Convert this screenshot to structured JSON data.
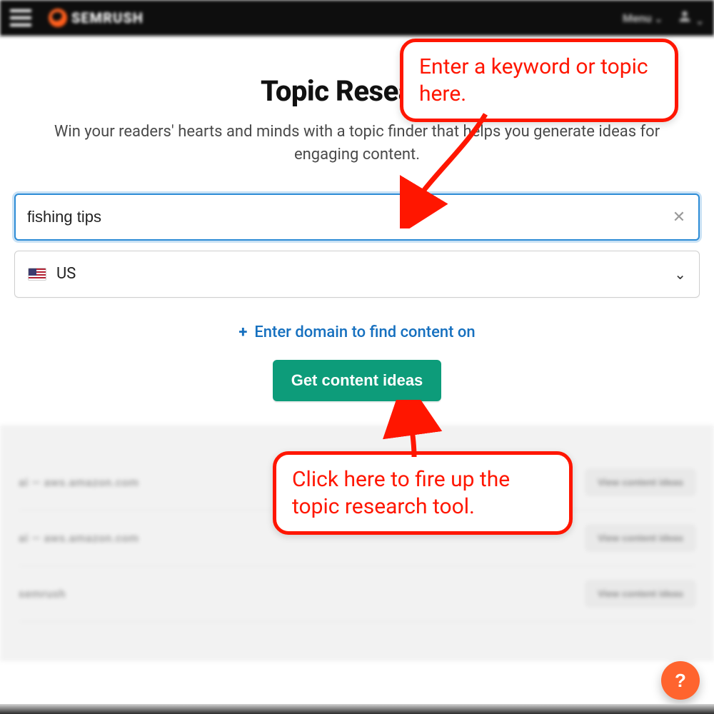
{
  "topbar": {
    "brand": "SEMRUSH",
    "menu_label": "Menu"
  },
  "page": {
    "title": "Topic Research",
    "subtitle": "Win your readers' hearts and minds with a topic finder that helps you generate ideas for engaging content."
  },
  "form": {
    "keyword_value": "fishing tips",
    "country_value": "US",
    "add_domain_label": "Enter domain to find content on",
    "cta_label": "Get content ideas"
  },
  "history": {
    "rows": [
      {
        "left": "ai — aws.amazon.com",
        "btn": "View content ideas"
      },
      {
        "left": "ai — aws.amazon.com",
        "btn": "View content ideas"
      },
      {
        "left": "semrush",
        "btn": "View content ideas"
      }
    ]
  },
  "annotations": {
    "callout1": "Enter a keyword or topic here.",
    "callout2": "Click here to fire up the topic research tool."
  },
  "help": {
    "label": "?"
  }
}
